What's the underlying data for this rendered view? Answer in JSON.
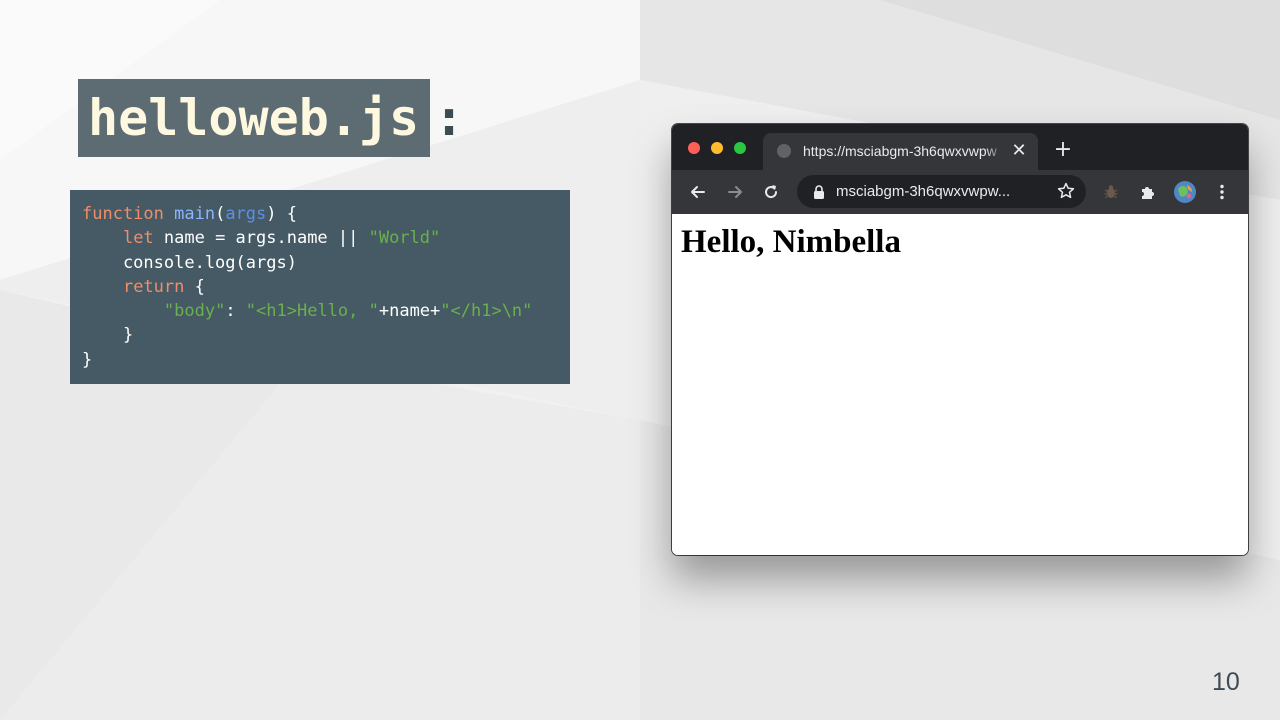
{
  "slide": {
    "title": "helloweb.js",
    "title_colon": ":",
    "page_number": "10"
  },
  "code": {
    "lines": [
      [
        {
          "t": "function ",
          "c": "kw"
        },
        {
          "t": "main",
          "c": "fn"
        },
        {
          "t": "(",
          "c": "plain"
        },
        {
          "t": "args",
          "c": "param"
        },
        {
          "t": ") {",
          "c": "plain"
        }
      ],
      [
        {
          "t": "    ",
          "c": "plain"
        },
        {
          "t": "let",
          "c": "kw"
        },
        {
          "t": " name = args.name || ",
          "c": "plain"
        },
        {
          "t": "\"World\"",
          "c": "str"
        }
      ],
      [
        {
          "t": "    console.log(args)",
          "c": "plain"
        }
      ],
      [
        {
          "t": "    ",
          "c": "plain"
        },
        {
          "t": "return",
          "c": "kw"
        },
        {
          "t": " {",
          "c": "plain"
        }
      ],
      [
        {
          "t": "        ",
          "c": "plain"
        },
        {
          "t": "\"body\"",
          "c": "str"
        },
        {
          "t": ": ",
          "c": "plain"
        },
        {
          "t": "\"<h1>Hello, \"",
          "c": "str"
        },
        {
          "t": "+name+",
          "c": "plain"
        },
        {
          "t": "\"</h1>\\n\"",
          "c": "str"
        }
      ],
      [
        {
          "t": "    }",
          "c": "plain"
        }
      ],
      [
        {
          "t": "}",
          "c": "plain"
        }
      ]
    ]
  },
  "browser": {
    "tab_title": "https://msciabgm-3h6qwxvwpw",
    "tab_close": "✕",
    "new_tab": "+",
    "url": "msciabgm-3h6qwxvwpw...",
    "page_heading": "Hello, Nimbella",
    "icons": {
      "back": "back-arrow-icon",
      "forward": "forward-arrow-icon",
      "reload": "reload-icon",
      "lock": "lock-icon",
      "bookmark": "star-icon",
      "bug": "bug-extension-icon",
      "extensions": "puzzle-icon",
      "profile": "profile-avatar-icon",
      "menu": "kebab-menu-icon"
    }
  },
  "colors": {
    "title_bg": "#5d6b72",
    "title_fg": "#fff8e1",
    "code_bg": "#455a64",
    "keyword": "#f08d6b",
    "function": "#8ab4ff",
    "string": "#6ab04c",
    "browser_chrome": "#202124",
    "browser_toolbar": "#35363a"
  }
}
